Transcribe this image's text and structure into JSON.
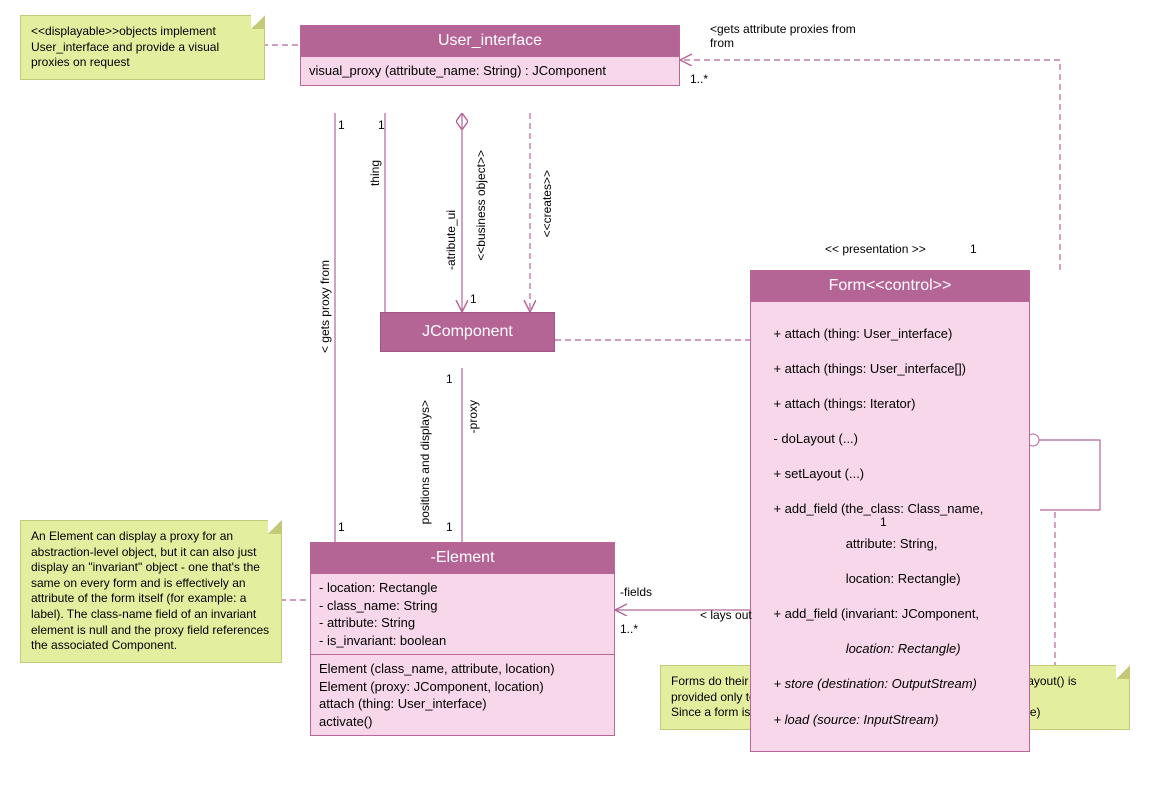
{
  "user_interface": {
    "title": "User_interface",
    "method": "visual_proxy (attribute_name: String) : JComponent"
  },
  "jcomponent": {
    "title": "JComponent"
  },
  "form": {
    "title": "Form<<control>>",
    "methods": [
      "+ attach (thing: User_interface)",
      "+ attach (things: User_interface[])",
      "+ attach (things: Iterator)",
      "- doLayout (...)",
      "+ setLayout (...)",
      "+ add_field (the_class: Class_name,",
      "                    attribute: String,",
      "                    location: Rectangle)",
      "+ add_field (invariant: JComponent,",
      "                    location: Rectangle)",
      "+ store (destination: OutputStream)",
      "+ load (source: InputStream)"
    ]
  },
  "element": {
    "title": "-Element",
    "attrs": [
      "- location: Rectangle",
      "- class_name: String",
      "- attribute: String",
      "- is_invariant: boolean"
    ],
    "methods": [
      "Element (class_name, attribute, location)",
      "Element (proxy: JComponent, location)",
      "attach (thing: User_interface)",
      "activate()"
    ]
  },
  "notes": {
    "displayable": "<<displayable>>objects implement User_interface and provide a visual proxies on request",
    "element_note": "An Element can display a proxy for an abstraction-level object, but it can also just display an \"invariant\" object - one that's the same on every form and is effectively an attribute of the form itself (for example: a label). The class-name field of an invariant element is null and the proxy field references the associated Component.",
    "form_note": "Forms do their own layout rather than using a layout manager. setLayout() is provided only to prevent you from adding a layout manager.\nSince a form is a JComponent, it can be used as a proxy (Composite)"
  },
  "labels": {
    "gets_attr_proxies": "<gets attribute proxies from",
    "one_star": "1..*",
    "one": "1",
    "thing": "thing",
    "gets_proxy_from": "< gets proxy from",
    "business_object": "<<business object>>",
    "creates": "<<creates>>",
    "attribute_ui": "-atribute_ui",
    "presentation": "<< presentation >>",
    "positions_displays": "positions and displays>",
    "proxy": "-proxy",
    "fields": "-fields",
    "lays_out": "< lays out"
  },
  "colors": {
    "header": "#b56496",
    "body": "#f7d7e9",
    "note": "#e3ee9e"
  }
}
